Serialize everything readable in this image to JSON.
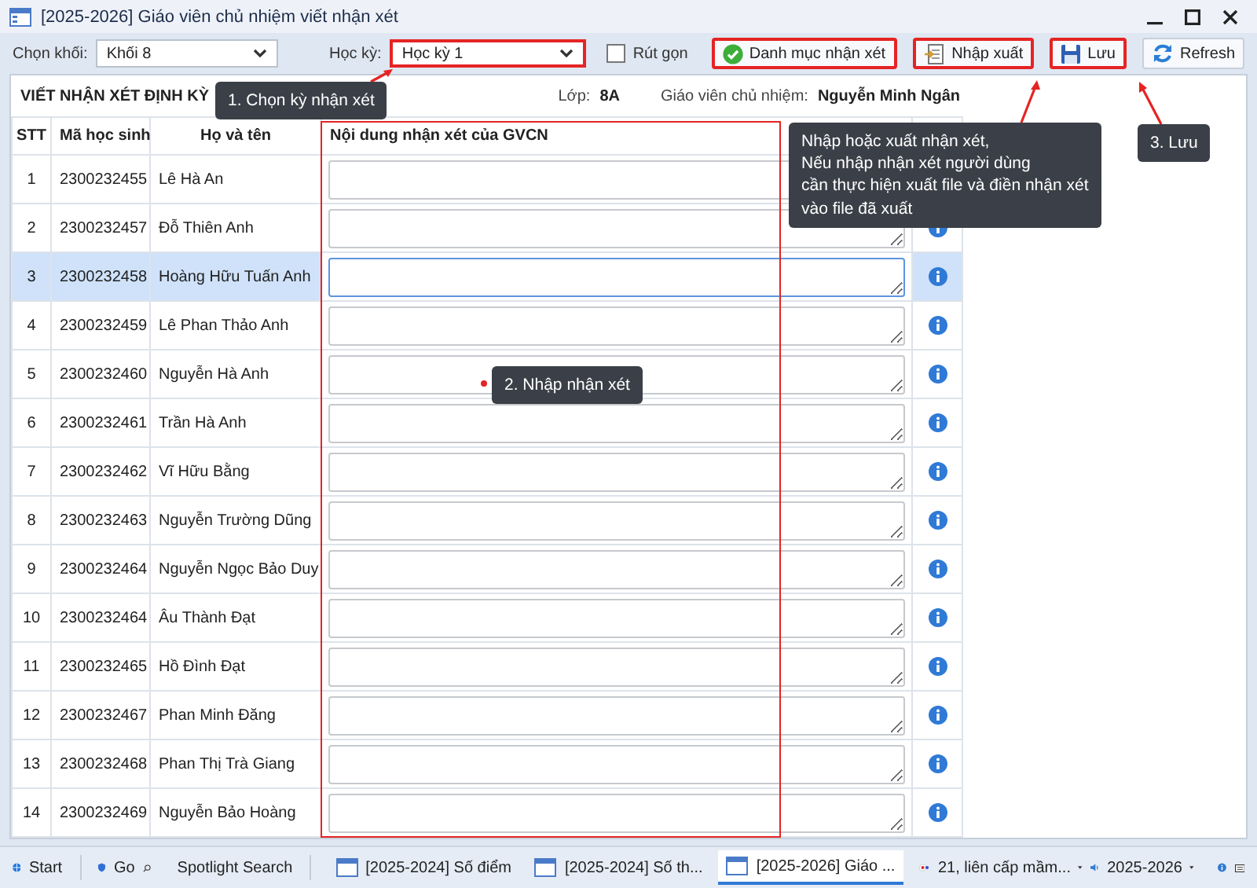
{
  "window": {
    "title": "[2025-2026] Giáo viên chủ nhiệm viết nhận xét"
  },
  "toolbar": {
    "grade_label": "Chọn khối:",
    "grade_value": "Khối 8",
    "term_label": "Học kỳ:",
    "term_value": "Học kỳ 1",
    "term_annotated": true,
    "collapse": {
      "label": "Rút gọn",
      "checked": false
    },
    "buttons": [
      {
        "label": "Danh mục nhận xét",
        "kind": "check",
        "annotated": true
      },
      {
        "label": "Nhập xuất",
        "kind": "import",
        "annotated": true
      },
      {
        "label": "Lưu",
        "kind": "save",
        "annotated": true
      },
      {
        "label": "Refresh",
        "kind": "refresh",
        "annotated": false
      }
    ]
  },
  "header": {
    "title": "VIẾT NHẬN XÉT ĐỊNH KỲ",
    "class_label": "Lớp:",
    "class_value": "8A",
    "teacher_label": "Giáo viên chủ nhiệm:",
    "teacher_value": "Nguyễn Minh Ngân"
  },
  "table": {
    "columns": [
      "STT",
      "Mã học sinh",
      "Họ và tên",
      "Nội dung nhận xét của GVCN"
    ],
    "comment_column_annotated": true,
    "rows": [
      {
        "stt": "1",
        "code": "2300232455",
        "name": "Lê Hà An",
        "selected": false
      },
      {
        "stt": "2",
        "code": "2300232457",
        "name": "Đỗ Thiên Anh",
        "selected": false
      },
      {
        "stt": "3",
        "code": "2300232458",
        "name": "Hoàng Hữu Tuấn Anh",
        "selected": true
      },
      {
        "stt": "4",
        "code": "2300232459",
        "name": "Lê Phan Thảo Anh",
        "selected": false
      },
      {
        "stt": "5",
        "code": "2300232460",
        "name": "Nguyễn Hà Anh",
        "selected": false
      },
      {
        "stt": "6",
        "code": "2300232461",
        "name": "Trần Hà Anh",
        "selected": false
      },
      {
        "stt": "7",
        "code": "2300232462",
        "name": "Vĩ Hữu Bằng",
        "selected": false
      },
      {
        "stt": "8",
        "code": "2300232463",
        "name": "Nguyễn Trường Dũng",
        "selected": false
      },
      {
        "stt": "9",
        "code": "2300232464",
        "name": "Nguyễn Ngọc Bảo Duy",
        "selected": false
      },
      {
        "stt": "10",
        "code": "2300232464",
        "name": "Âu Thành Đạt",
        "selected": false
      },
      {
        "stt": "11",
        "code": "2300232465",
        "name": "Hồ Đình Đạt",
        "selected": false
      },
      {
        "stt": "12",
        "code": "2300232467",
        "name": "Phan Minh Đăng",
        "selected": false
      },
      {
        "stt": "13",
        "code": "2300232468",
        "name": "Phan Thị Trà Giang",
        "selected": false
      },
      {
        "stt": "14",
        "code": "2300232469",
        "name": "Nguyễn Bảo Hoàng",
        "selected": false
      }
    ]
  },
  "callouts": [
    {
      "lines": [
        "1. Chọn kỳ nhận xét"
      ]
    },
    {
      "lines": [
        "2. Nhập nhận xét"
      ]
    },
    {
      "lines": [
        "Nhập hoặc xuất nhận xét,",
        "Nếu nhập nhận xét người dùng",
        "cần thực hiện xuất file và điền nhận xét",
        "vào file đã xuất"
      ]
    },
    {
      "lines": [
        "3. Lưu"
      ]
    }
  ],
  "taskbar": {
    "start": "Start",
    "go": "Go",
    "search": "Spotlight Search",
    "tasks": [
      {
        "label": "[2025-2024] Số điểm",
        "selected": false
      },
      {
        "label": "[2025-2024] Số th...",
        "selected": false
      },
      {
        "label": "[2025-2026] Giáo ...",
        "selected": true
      }
    ],
    "network": "21, liên cấp mầm...",
    "year": "2025-2026"
  }
}
